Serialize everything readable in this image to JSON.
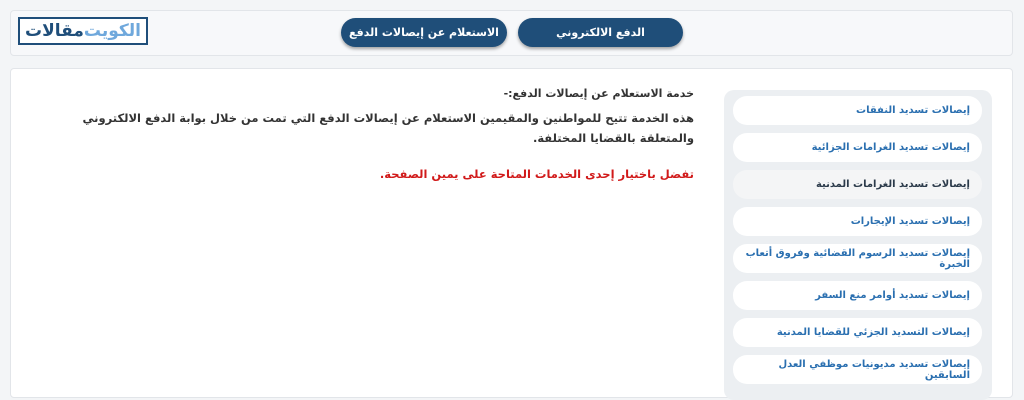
{
  "header": {
    "logo": {
      "main": "مقالات",
      "accent": "الكويت"
    },
    "nav": [
      {
        "label": "الاستعلام عن إيصالات الدفع"
      },
      {
        "label": "الدفع الالكتروني"
      }
    ]
  },
  "content": {
    "title": "خدمة الاستعلام عن إيصالات الدفع:-",
    "description": "هذه الخدمة تتيح للمواطنين والمقيمين الاستعلام عن إيصالات الدفع التي تمت من خلال بوابة الدفع الالكتروني والمتعلقة بالقضايا المختلفة.",
    "note": "تفضل باختيار إحدى الخدمات المتاحة على يمين الصفحة."
  },
  "sidebar": {
    "items": [
      {
        "label": "إيصالات تسديد النفقات"
      },
      {
        "label": "إيصالات تسديد الغرامات الجزائية"
      },
      {
        "label": "إيصالات تسديد الغرامات المدنية"
      },
      {
        "label": "إيصالات تسديد الإيجارات"
      },
      {
        "label": "إيصالات تسديد الرسوم القضائية وفروق أتعاب الخبرة"
      },
      {
        "label": "إيصالات تسديد أوامر منع السفر"
      },
      {
        "label": "إيصالات التسديد الجزئي للقضايا المدنية"
      },
      {
        "label": "إيصالات تسديد مديونيات موظفي العدل السابقين"
      }
    ]
  }
}
